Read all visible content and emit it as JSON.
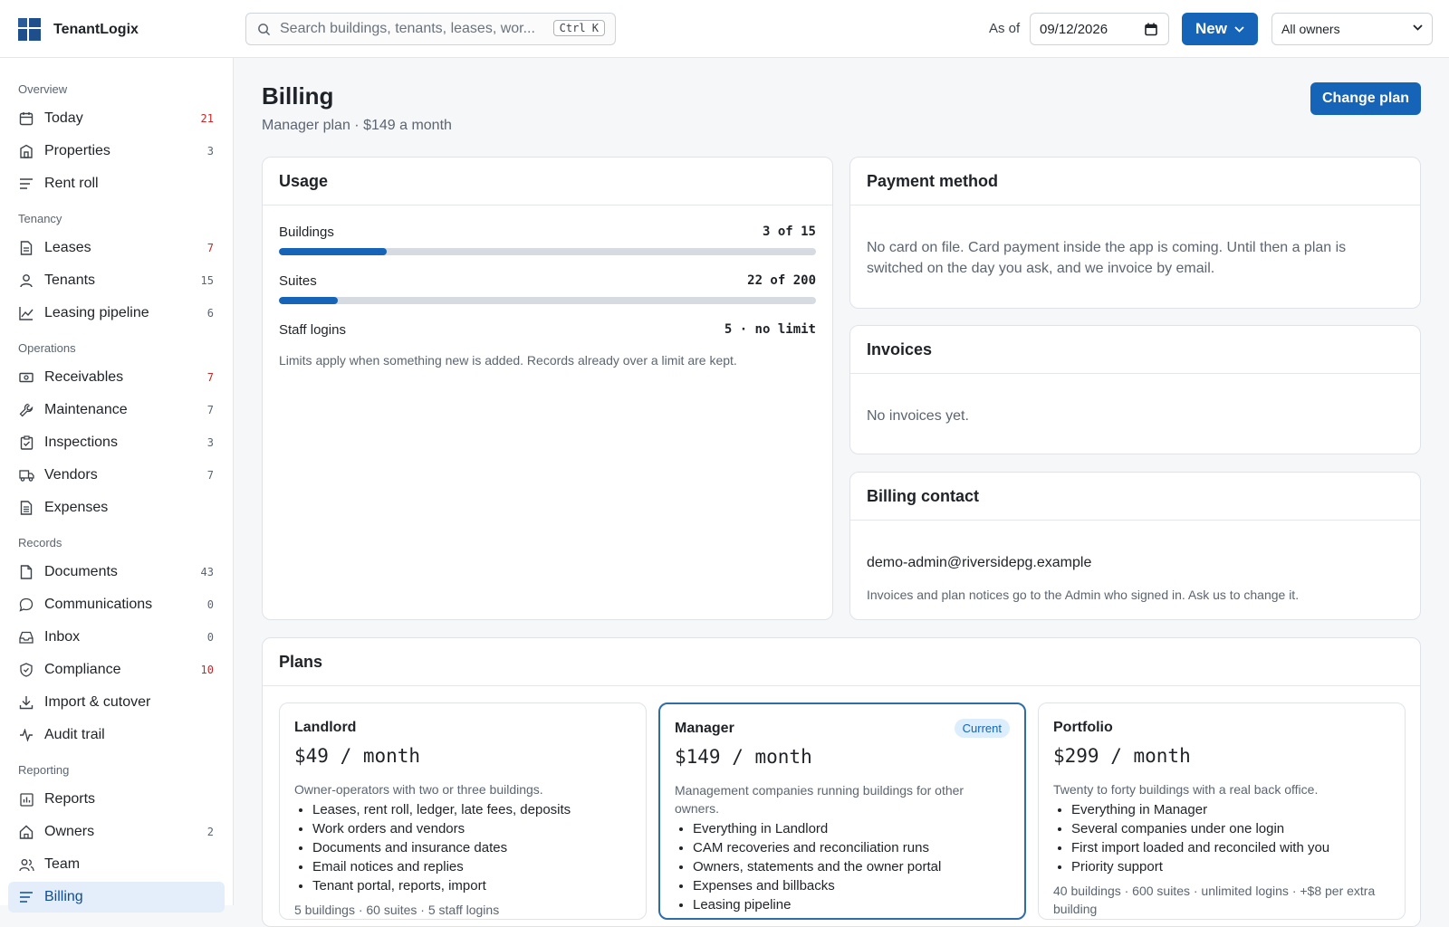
{
  "app": {
    "name": "TenantLogix"
  },
  "colors": {
    "accent": "#1664b8",
    "alert": "#c62828",
    "active_bg": "#e3eefa"
  },
  "topbar": {
    "search_placeholder": "Search buildings, tenants, leases, wor...",
    "search_shortcut": "Ctrl K",
    "as_of_label": "As of",
    "as_of_date": "09/12/2026",
    "new_label": "New",
    "owner_filter": "All owners"
  },
  "sidebar": {
    "sections": {
      "overview": "Overview",
      "tenancy": "Tenancy",
      "operations": "Operations",
      "records": "Records",
      "reporting": "Reporting"
    },
    "items": [
      {
        "label": "Today",
        "count": "21",
        "icon": "calendar-icon",
        "alert": true
      },
      {
        "label": "Properties",
        "count": "3",
        "icon": "building-icon"
      },
      {
        "label": "Rent roll",
        "count": "",
        "icon": "list-icon"
      },
      {
        "label": "Leases",
        "count": "7",
        "icon": "document-icon",
        "alert": true
      },
      {
        "label": "Tenants",
        "count": "15",
        "icon": "person-icon"
      },
      {
        "label": "Leasing pipeline",
        "count": "6",
        "icon": "chart-icon"
      },
      {
        "label": "Receivables",
        "count": "7",
        "icon": "cash-icon",
        "alert": true
      },
      {
        "label": "Maintenance",
        "count": "7",
        "icon": "wrench-icon"
      },
      {
        "label": "Inspections",
        "count": "3",
        "icon": "clipboard-icon"
      },
      {
        "label": "Vendors",
        "count": "7",
        "icon": "truck-icon"
      },
      {
        "label": "Expenses",
        "count": "",
        "icon": "receipt-icon"
      },
      {
        "label": "Documents",
        "count": "43",
        "icon": "file-icon"
      },
      {
        "label": "Communications",
        "count": "0",
        "icon": "chat-icon"
      },
      {
        "label": "Inbox",
        "count": "0",
        "icon": "inbox-icon"
      },
      {
        "label": "Compliance",
        "count": "10",
        "icon": "shield-icon",
        "alert": true
      },
      {
        "label": "Import & cutover",
        "count": "",
        "icon": "download-icon"
      },
      {
        "label": "Audit trail",
        "count": "",
        "icon": "activity-icon"
      },
      {
        "label": "Reports",
        "count": "",
        "icon": "report-icon"
      },
      {
        "label": "Owners",
        "count": "2",
        "icon": "home-icon"
      },
      {
        "label": "Team",
        "count": "",
        "icon": "team-icon"
      },
      {
        "label": "Billing",
        "count": "",
        "icon": "list-icon",
        "active": true
      }
    ]
  },
  "main": {
    "title": "Billing",
    "subtitle": "Manager plan · $149 a month",
    "change_plan_label": "Change plan",
    "usage": {
      "title": "Usage",
      "rows": [
        {
          "name": "Buildings",
          "value": "3 of 15",
          "fraction": 0.2
        },
        {
          "name": "Suites",
          "value": "22 of 200",
          "fraction": 0.11
        },
        {
          "name": "Staff logins",
          "value": "5 · no limit"
        }
      ],
      "note": "Limits apply when something new is added. Records already over a limit are kept."
    },
    "payment": {
      "title": "Payment method",
      "text": "No card on file. Card payment inside the app is coming. Until then a plan is switched on the day you ask, and we invoice by email."
    },
    "invoices": {
      "title": "Invoices",
      "text": "No invoices yet."
    },
    "billing_contact": {
      "title": "Billing contact",
      "email": "demo-admin@riversidepg.example",
      "note": "Invoices and plan notices go to the Admin who signed in. Ask us to change it."
    },
    "plans": {
      "title": "Plans",
      "items": [
        {
          "name": "Landlord",
          "price": "$49 / month",
          "desc": "Owner-operators with two or three buildings.",
          "features": [
            "Leases, rent roll, ledger, late fees, deposits",
            "Work orders and vendors",
            "Documents and insurance dates",
            "Email notices and replies",
            "Tenant portal, reports, import"
          ],
          "footer": "5 buildings · 60 suites · 5 staff logins"
        },
        {
          "name": "Manager",
          "badge": "Current",
          "price": "$149 / month",
          "desc": "Management companies running buildings for other owners.",
          "features": [
            "Everything in Landlord",
            "CAM recoveries and reconciliation runs",
            "Owners, statements and the owner portal",
            "Expenses and billbacks",
            "Leasing pipeline"
          ],
          "footer": ""
        },
        {
          "name": "Portfolio",
          "price": "$299 / month",
          "desc": "Twenty to forty buildings with a real back office.",
          "features": [
            "Everything in Manager",
            "Several companies under one login",
            "First import loaded and reconciled with you",
            "Priority support"
          ],
          "footer": "40 buildings · 600 suites · unlimited logins · +$8 per extra building"
        }
      ]
    }
  }
}
